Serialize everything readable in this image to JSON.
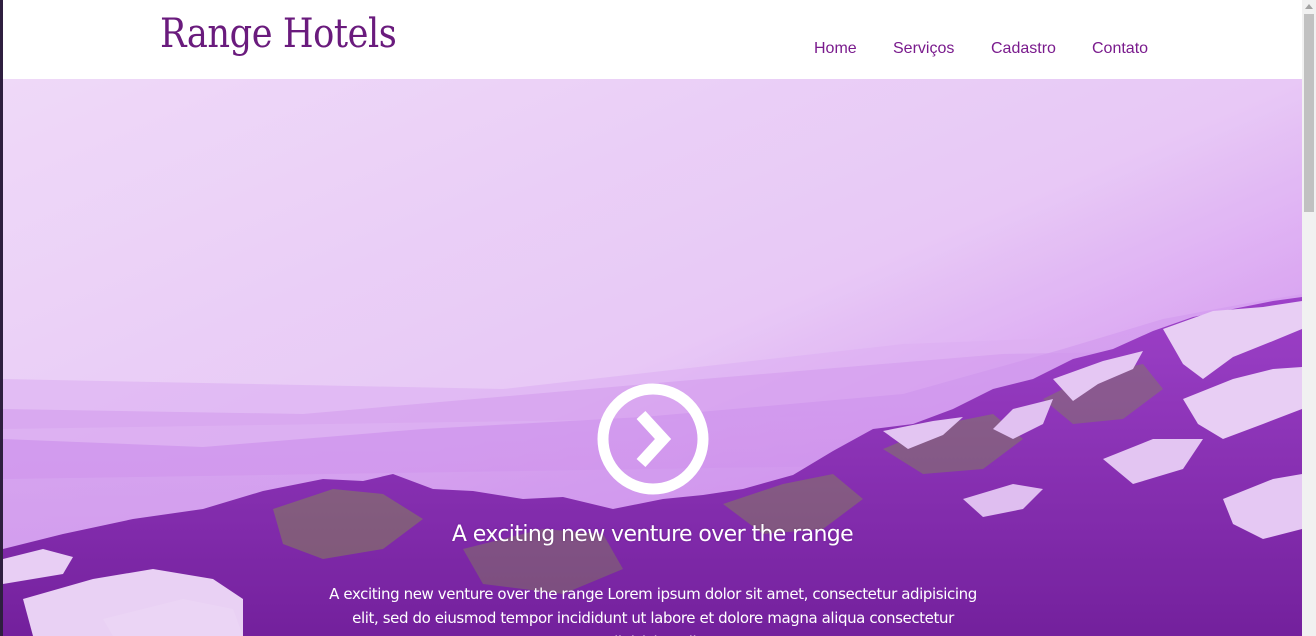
{
  "brand": {
    "logo_text": "Range Hotels",
    "color": "#6a1b7d"
  },
  "nav": {
    "items": [
      {
        "label": "Home"
      },
      {
        "label": "Serviços"
      },
      {
        "label": "Cadastro"
      },
      {
        "label": "Contato"
      }
    ],
    "color": "#7a1b8d"
  },
  "hero": {
    "icon": "play-circle-icon",
    "title": "A exciting new venture over the range",
    "text": "A exciting new venture over the range Lorem ipsum dolor sit amet, consectetur adipisicing elit, sed do eiusmod tempor incididunt ut labore et dolore magna aliqua consectetur adipisicing elit.",
    "overlay_color": "#b964de"
  }
}
